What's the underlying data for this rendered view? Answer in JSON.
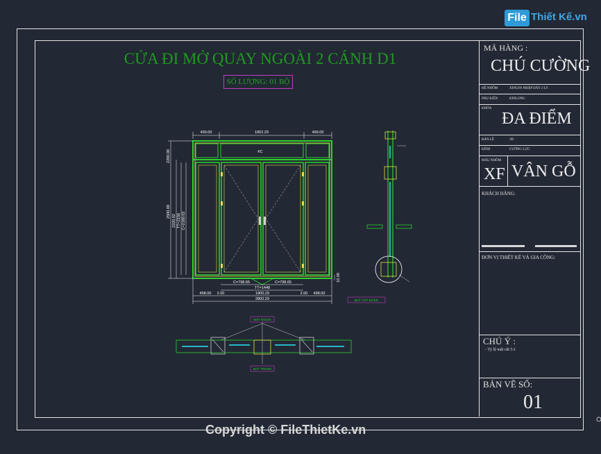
{
  "logo": {
    "file": "File",
    "rest": "Thiết Kế.vn"
  },
  "drawing": {
    "title": "CỬA ĐI MỞ QUAY NGOÀI 2 CÁNH D1",
    "quantity": "SỐ LƯỢNG: 01 BỘ",
    "dims_top": [
      "499.00",
      "1802.29",
      "499.00"
    ],
    "dims_bottom_row1": [
      "C=798.65",
      "C=798.65"
    ],
    "dims_bottom_row2": [
      "TT=1448"
    ],
    "dims_bottom_row3": [
      "498.00",
      "2.00",
      "1800.29",
      "2.00",
      "498.00"
    ],
    "dims_bottom_row4": [
      "2800.29"
    ],
    "dims_left": [
      "2500.00",
      "2220.02",
      "TT=2156",
      "C=2180.02"
    ],
    "dims_left_top": "2200.00",
    "dim_right": "10.00",
    "side_label": "MẶT CẮT ĐỨNG",
    "plan_label_top": "MẶT NGOÀI",
    "plan_label_bottom": "MẶT TRONG",
    "transom_label": "KC"
  },
  "titleblock": {
    "ma_hang_label": "MÃ HÀNG :",
    "ma_hang_value": "CHÚ CƯỜNG",
    "row1_label": "HỆ NHÔM",
    "row1_value": "XINGFA NHẬP DÀY 2 LY",
    "row2_label": "PHỤ KIỆN",
    "row2_value": "KINLONG",
    "khoa_label": "KHÓA",
    "dia_diem": "ĐA ĐIỂM",
    "row3_label": "BẢN LỀ",
    "row3_value": "3D",
    "row4_label": "KÍNH",
    "row4_value": "CƯỜNG LỰC",
    "mau_label": "MÀU NHÔM",
    "mau_code": "XF",
    "mau_value": "VÂN GỖ",
    "khach_hang": "KHÁCH HÀNG:",
    "don_vi": "ĐƠN VỊ THIẾT KẾ VÀ GIA CÔNG:",
    "chu_y": "CHÚ Ý :",
    "ty_le": "- Tỷ lệ mặt cắt 5:1",
    "ban_ve_so": "BẢN VẼ SỐ:",
    "sheet_no": "01"
  },
  "copyright": "Copyright © FileThietKe.vn",
  "colors": {
    "background": "#222834",
    "frame": "#2fd32f",
    "glass": "#27b6c9",
    "dims": "#ffffff",
    "title": "#1f9a1f",
    "accent": "#e3e34a"
  }
}
